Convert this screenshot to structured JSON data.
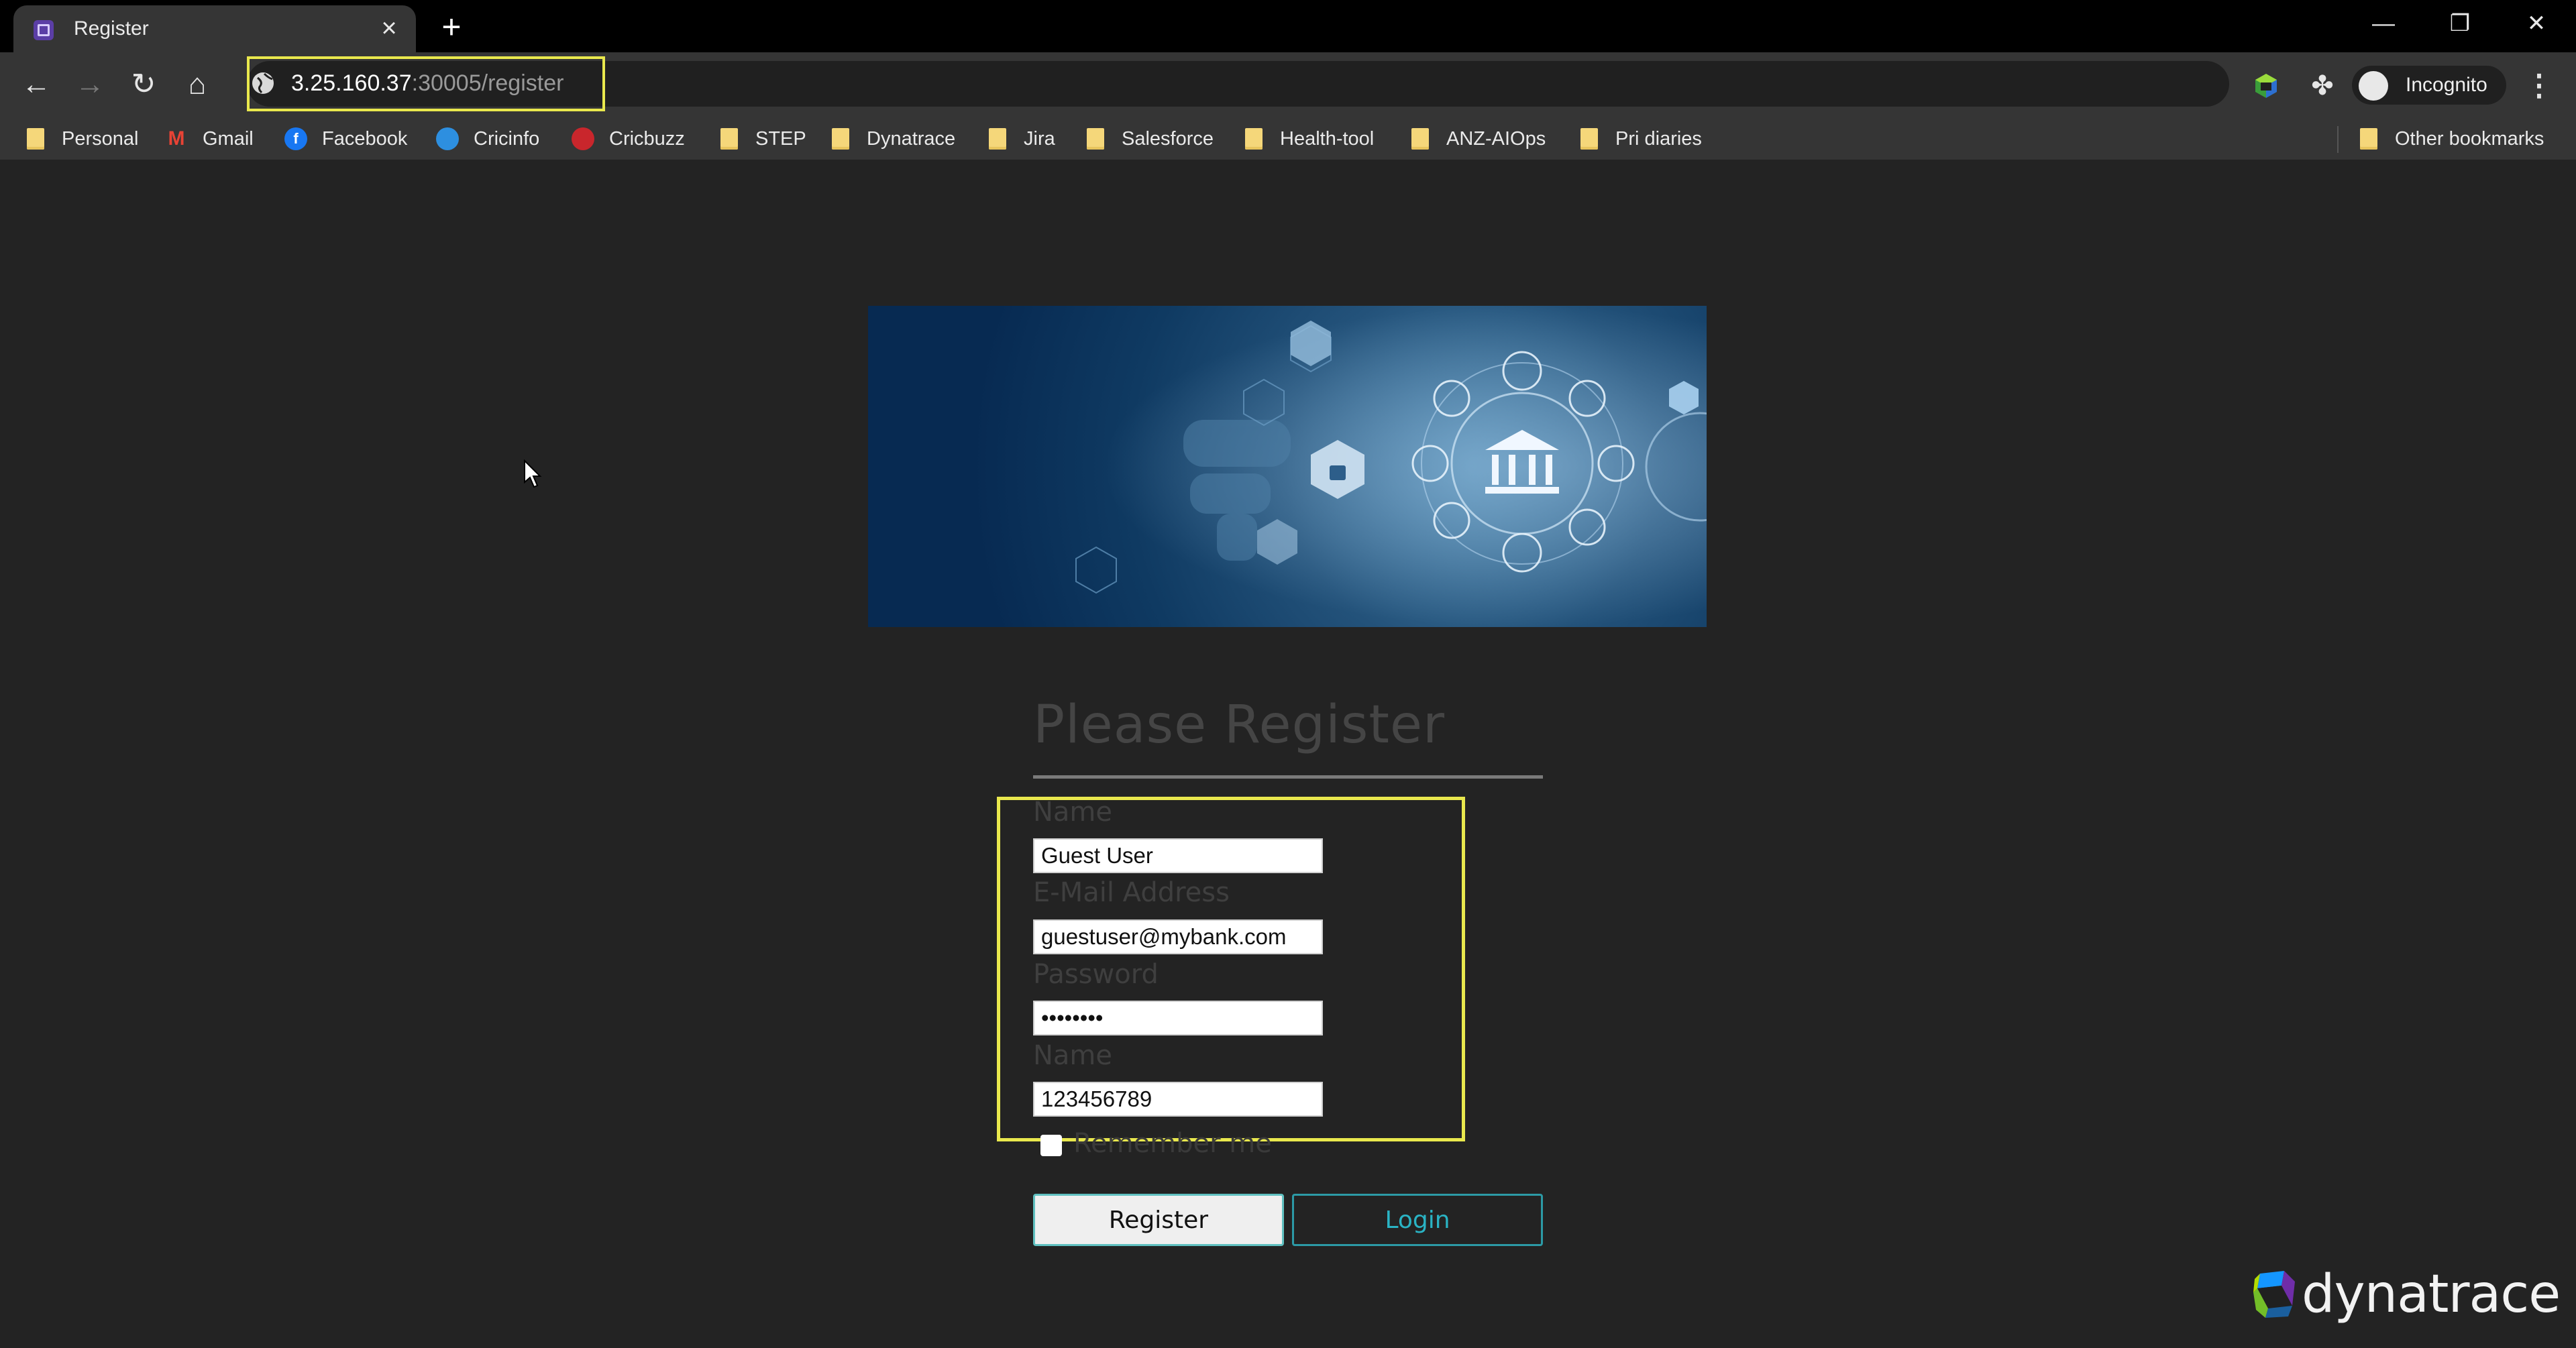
{
  "browser": {
    "tab_title": "Register",
    "url_host": "3.25.160.37",
    "url_rest": ":30005/register",
    "profile_label": "Incognito",
    "bookmarks": [
      {
        "label": "Personal",
        "icon": "folder-icon"
      },
      {
        "label": "Gmail",
        "icon": "gmail-icon"
      },
      {
        "label": "Facebook",
        "icon": "facebook-icon"
      },
      {
        "label": "Cricinfo",
        "icon": "cricinfo-icon"
      },
      {
        "label": "Cricbuzz",
        "icon": "cricbuzz-icon"
      },
      {
        "label": "STEP",
        "icon": "folder-icon"
      },
      {
        "label": "Dynatrace",
        "icon": "folder-icon"
      },
      {
        "label": "Jira",
        "icon": "folder-icon"
      },
      {
        "label": "Salesforce",
        "icon": "folder-icon"
      },
      {
        "label": "Health-tool",
        "icon": "folder-icon"
      },
      {
        "label": "ANZ-AIOps",
        "icon": "folder-icon"
      },
      {
        "label": "Pri diaries",
        "icon": "folder-icon"
      }
    ],
    "other_bookmarks": "Other bookmarks"
  },
  "form": {
    "title": "Please Register",
    "name_label": "Name",
    "name_value": "Guest User",
    "email_label": "E-Mail Address",
    "email_value": "guestuser@mybank.com",
    "password_label": "Password",
    "password_value": "••••••••",
    "phone_label": "Name",
    "phone_value": "123456789",
    "remember_label": "Remember me",
    "register_label": "Register",
    "login_label": "Login"
  },
  "branding": {
    "logo_text": "dynatrace"
  },
  "colors": {
    "page_bg": "#232323",
    "highlight": "#e9e84d",
    "login_accent": "#2ab3c4"
  }
}
